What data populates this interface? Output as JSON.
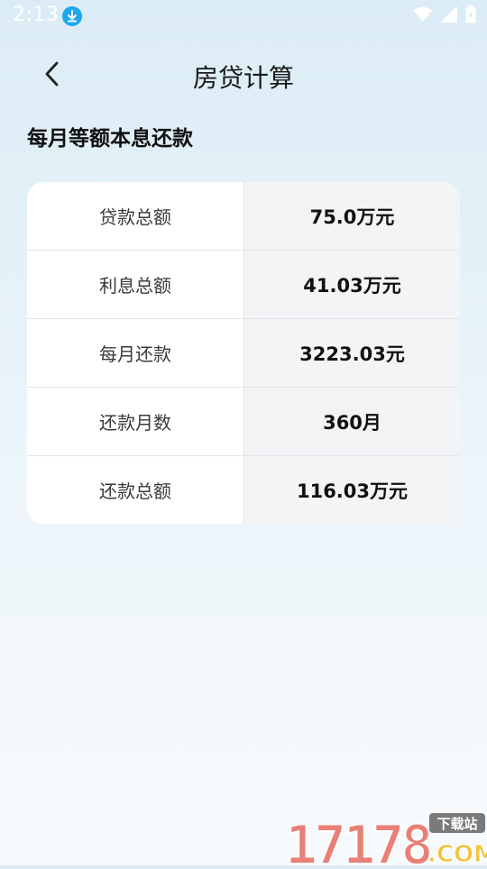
{
  "status_bar": {
    "time": "2:13",
    "icons": [
      "download-icon",
      "wifi-icon",
      "signal-icon",
      "battery-icon"
    ]
  },
  "app_bar": {
    "title": "房贷计算",
    "back_icon": "chevron-left-icon"
  },
  "section": {
    "title": "每月等额本息还款"
  },
  "results": [
    {
      "label": "贷款总额",
      "value": "75.0万元"
    },
    {
      "label": "利息总额",
      "value": "41.03万元"
    },
    {
      "label": "每月还款",
      "value": "3223.03元"
    },
    {
      "label": "还款月数",
      "value": "360月"
    },
    {
      "label": "还款总额",
      "value": "116.03万元"
    }
  ],
  "watermark": {
    "number": "17178",
    "badge": "下载站",
    "suffix": ".COM"
  },
  "colors": {
    "background_top": "#dcecf6",
    "background_bottom": "#f7fafc",
    "download_badge": "#1aa8f0",
    "value_cell": "#f3f4f5",
    "watermark_red": "#e8736a",
    "watermark_yellow": "#f1c43a"
  }
}
